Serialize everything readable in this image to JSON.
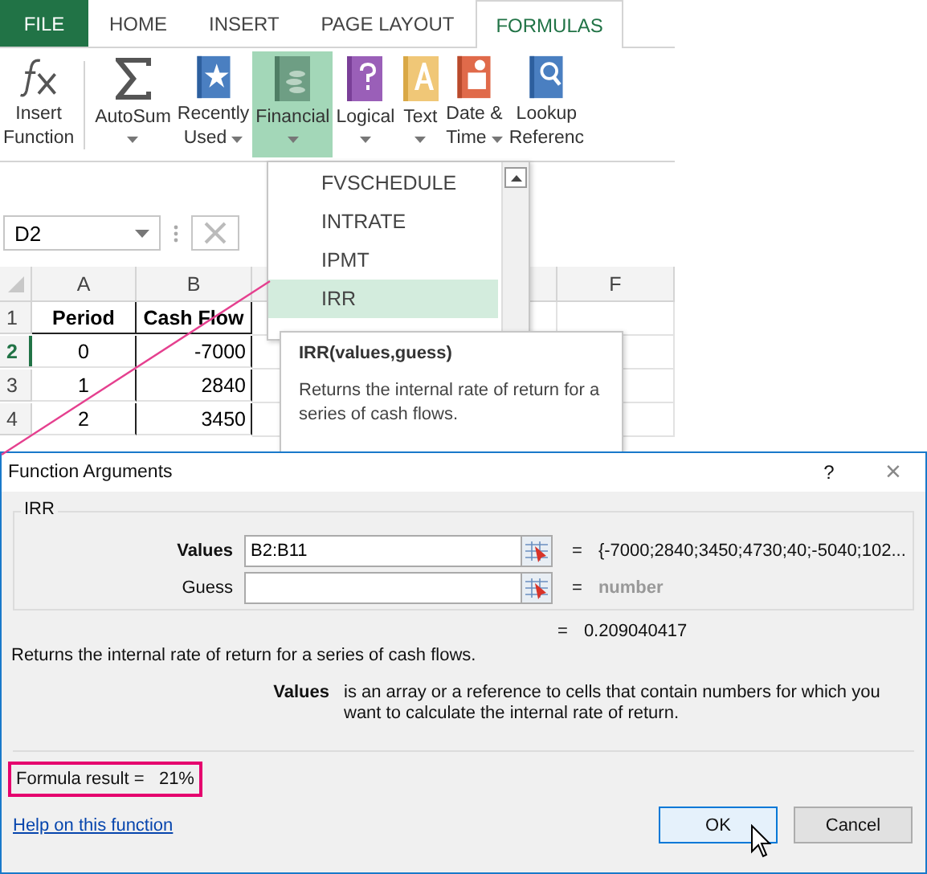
{
  "ribbon_tabs": [
    {
      "label": "FILE",
      "kind": "file",
      "selected": false
    },
    {
      "label": "HOME",
      "kind": "tab",
      "selected": false
    },
    {
      "label": "INSERT",
      "kind": "tab",
      "selected": false
    },
    {
      "label": "PAGE LAYOUT",
      "kind": "tab",
      "selected": false
    },
    {
      "label": "FORMULAS",
      "kind": "tab",
      "selected": true
    }
  ],
  "ribbon_buttons": [
    {
      "kind": "fx",
      "lines": [
        "Insert",
        "Function"
      ],
      "caret": false,
      "selected": false
    },
    {
      "kind": "sigma",
      "lines": [
        "AutoSum"
      ],
      "caret": true,
      "selected": false
    },
    {
      "kind": "star",
      "lines": [
        "Recently",
        "Used"
      ],
      "caret": true,
      "selected": false
    },
    {
      "kind": "coins",
      "lines": [
        "Financial"
      ],
      "caret": true,
      "selected": true
    },
    {
      "kind": "question",
      "lines": [
        "Logical"
      ],
      "caret": true,
      "selected": false
    },
    {
      "kind": "letter",
      "lines": [
        "Text"
      ],
      "caret": true,
      "selected": false
    },
    {
      "kind": "calendar",
      "lines": [
        "Date &",
        "Time"
      ],
      "caret": true,
      "selected": false
    },
    {
      "kind": "lookup",
      "lines": [
        "Lookup",
        "Referenc"
      ],
      "caret": false,
      "selected": false
    }
  ],
  "name_box": {
    "value": "D2"
  },
  "sheet": {
    "columns": [
      "A",
      "B",
      "",
      "F"
    ],
    "rows": [
      {
        "number": "1",
        "selected": false,
        "header": true,
        "cells": [
          "Period",
          "Cash Flow"
        ]
      },
      {
        "number": "2",
        "selected": true,
        "header": false,
        "cells": [
          "0",
          "-7000"
        ]
      },
      {
        "number": "3",
        "selected": false,
        "header": false,
        "cells": [
          "1",
          "2840"
        ]
      },
      {
        "number": "4",
        "selected": false,
        "header": false,
        "cells": [
          "2",
          "3450"
        ]
      }
    ]
  },
  "function_menu": {
    "items": [
      {
        "label": "FVSCHEDULE",
        "selected": false
      },
      {
        "label": "INTRATE",
        "selected": false
      },
      {
        "label": "IPMT",
        "selected": false
      },
      {
        "label": "IRR",
        "selected": true
      }
    ]
  },
  "tooltip": {
    "title": "IRR(values,guess)",
    "text": "Returns the internal rate of return for a series of cash flows."
  },
  "dialog": {
    "title": "Function Arguments",
    "help_glyph": "?",
    "close_glyph": "×",
    "function_name": "IRR",
    "arguments": [
      {
        "label": "Values",
        "bold": true,
        "value": "B2:B11",
        "equals": "=",
        "result": "{-7000;2840;3450;4730;40;-5040;102...",
        "muted": false
      },
      {
        "label": "Guess",
        "bold": false,
        "equals": "=",
        "result": "number",
        "muted": true
      }
    ],
    "result_equals": "=",
    "result": "0.209040417",
    "description": "Returns the internal rate of return for a series of cash flows.",
    "argument_name": "Values",
    "argument_help": "is an array or a reference to cells that contain numbers for which you want to calculate the internal rate of return.",
    "formula_result": "Formula result =   21%",
    "help_link": "Help on this function",
    "buttons": [
      {
        "label": "OK",
        "focused": true
      },
      {
        "label": "Cancel",
        "focused": false
      }
    ]
  }
}
